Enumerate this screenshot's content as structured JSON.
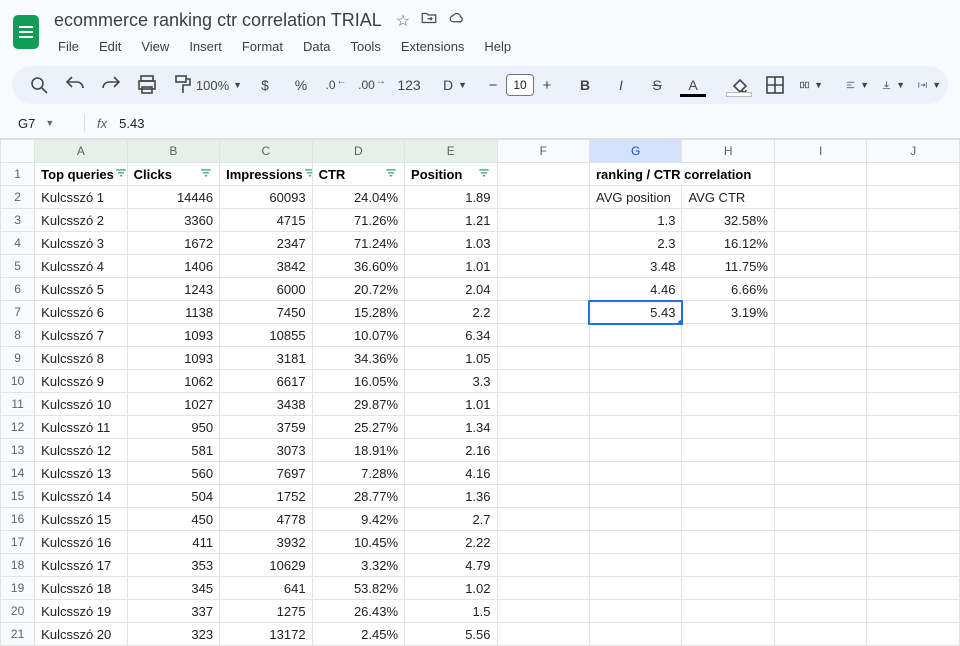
{
  "app": {
    "docTitle": "ecommerce ranking ctr correlation TRIAL",
    "menus": [
      "File",
      "Edit",
      "View",
      "Insert",
      "Format",
      "Data",
      "Tools",
      "Extensions",
      "Help"
    ],
    "zoom": "100%",
    "fontName": "Defaul...",
    "fontSize": "10"
  },
  "namebox": {
    "cell": "G7",
    "formula": "5.43"
  },
  "columns": [
    "A",
    "B",
    "C",
    "D",
    "E",
    "F",
    "G",
    "H",
    "I",
    "J"
  ],
  "headers": {
    "A": "Top queries",
    "B": "Clicks",
    "C": "Impressions",
    "D": "CTR",
    "E": "Position"
  },
  "sideHeader": "ranking / CTR correlation",
  "sideLabels": {
    "G": "AVG position",
    "H": "AVG CTR"
  },
  "rows": [
    {
      "A": "Kulcsszó 1",
      "B": "14446",
      "C": "60093",
      "D": "24.04%",
      "E": "1.89"
    },
    {
      "A": "Kulcsszó 2",
      "B": "3360",
      "C": "4715",
      "D": "71.26%",
      "E": "1.21",
      "G": "1.3",
      "H": "32.58%"
    },
    {
      "A": "Kulcsszó 3",
      "B": "1672",
      "C": "2347",
      "D": "71.24%",
      "E": "1.03",
      "G": "2.3",
      "H": "16.12%"
    },
    {
      "A": "Kulcsszó 4",
      "B": "1406",
      "C": "3842",
      "D": "36.60%",
      "E": "1.01",
      "G": "3.48",
      "H": "11.75%"
    },
    {
      "A": "Kulcsszó 5",
      "B": "1243",
      "C": "6000",
      "D": "20.72%",
      "E": "2.04",
      "G": "4.46",
      "H": "6.66%"
    },
    {
      "A": "Kulcsszó 6",
      "B": "1138",
      "C": "7450",
      "D": "15.28%",
      "E": "2.2",
      "G": "5.43",
      "H": "3.19%"
    },
    {
      "A": "Kulcsszó 7",
      "B": "1093",
      "C": "10855",
      "D": "10.07%",
      "E": "6.34"
    },
    {
      "A": "Kulcsszó 8",
      "B": "1093",
      "C": "3181",
      "D": "34.36%",
      "E": "1.05"
    },
    {
      "A": "Kulcsszó 9",
      "B": "1062",
      "C": "6617",
      "D": "16.05%",
      "E": "3.3"
    },
    {
      "A": "Kulcsszó 10",
      "B": "1027",
      "C": "3438",
      "D": "29.87%",
      "E": "1.01"
    },
    {
      "A": "Kulcsszó 11",
      "B": "950",
      "C": "3759",
      "D": "25.27%",
      "E": "1.34"
    },
    {
      "A": "Kulcsszó 12",
      "B": "581",
      "C": "3073",
      "D": "18.91%",
      "E": "2.16"
    },
    {
      "A": "Kulcsszó 13",
      "B": "560",
      "C": "7697",
      "D": "7.28%",
      "E": "4.16"
    },
    {
      "A": "Kulcsszó 14",
      "B": "504",
      "C": "1752",
      "D": "28.77%",
      "E": "1.36"
    },
    {
      "A": "Kulcsszó 15",
      "B": "450",
      "C": "4778",
      "D": "9.42%",
      "E": "2.7"
    },
    {
      "A": "Kulcsszó 16",
      "B": "411",
      "C": "3932",
      "D": "10.45%",
      "E": "2.22"
    },
    {
      "A": "Kulcsszó 17",
      "B": "353",
      "C": "10629",
      "D": "3.32%",
      "E": "4.79"
    },
    {
      "A": "Kulcsszó 18",
      "B": "345",
      "C": "641",
      "D": "53.82%",
      "E": "1.02"
    },
    {
      "A": "Kulcsszó 19",
      "B": "337",
      "C": "1275",
      "D": "26.43%",
      "E": "1.5"
    },
    {
      "A": "Kulcsszó 20",
      "B": "323",
      "C": "13172",
      "D": "2.45%",
      "E": "5.56"
    }
  ],
  "chart_data": {
    "type": "table",
    "title": "ranking / CTR correlation",
    "series": [
      {
        "name": "AVG position",
        "values": [
          1.3,
          2.3,
          3.48,
          4.46,
          5.43
        ]
      },
      {
        "name": "AVG CTR",
        "values": [
          32.58,
          16.12,
          11.75,
          6.66,
          3.19
        ]
      }
    ]
  }
}
